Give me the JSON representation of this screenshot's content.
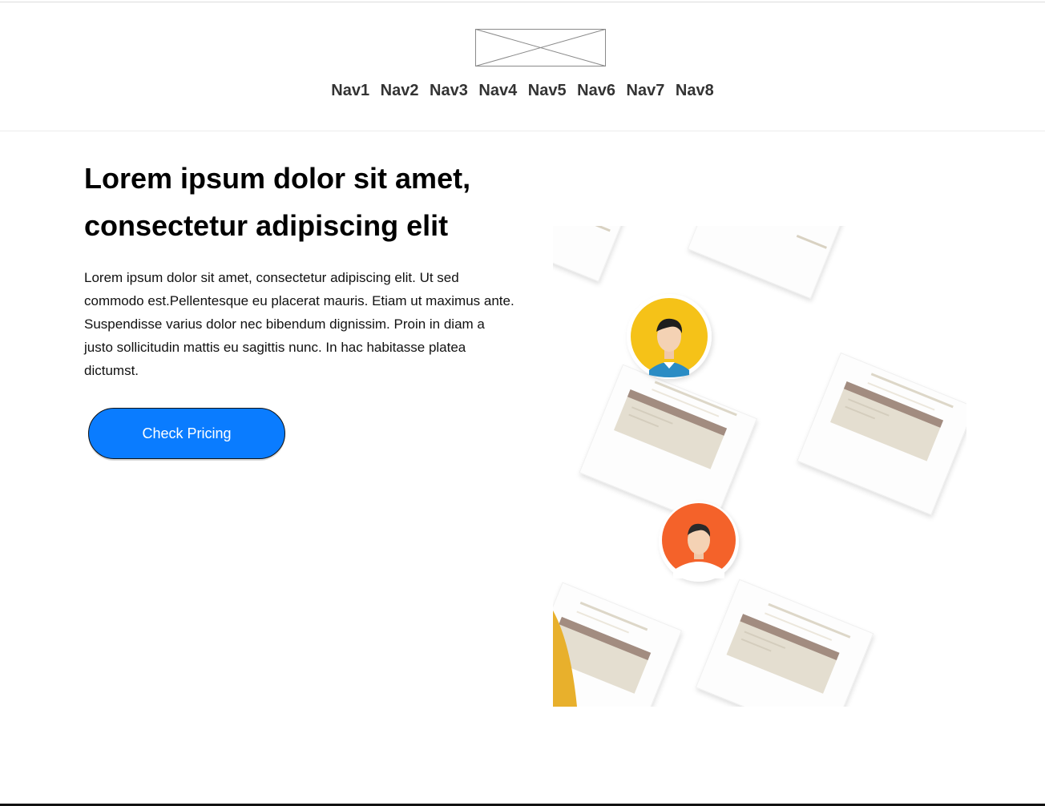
{
  "header": {
    "logo_alt": "logo placeholder",
    "logo_icon": "image-placeholder-icon",
    "nav": [
      {
        "label": "Nav1"
      },
      {
        "label": "Nav2"
      },
      {
        "label": "Nav3"
      },
      {
        "label": "Nav4"
      },
      {
        "label": "Nav5"
      },
      {
        "label": "Nav6"
      },
      {
        "label": "Nav7"
      },
      {
        "label": "Nav8"
      }
    ]
  },
  "hero": {
    "title": "Lorem ipsum dolor sit amet, consectetur adipiscing elit",
    "body": "Lorem ipsum dolor sit amet, consectetur adipiscing elit. Ut sed commodo est.Pellentesque eu placerat mauris. Etiam ut maximus ante. Suspendisse varius dolor nec bibendum dignissim. Proin in diam a justo sollicitudin mattis eu sagittis nunc. In hac habitasse platea dictumst.",
    "cta_label": "Check Pricing",
    "illustration_icon": "profile-cards-illustration-icon"
  },
  "colors": {
    "cta_background": "#0a7cff",
    "avatar_yellow": "#f5c218",
    "avatar_orange": "#f4622a",
    "card_band": "#a28c80",
    "card_fill": "#e4ded0"
  }
}
